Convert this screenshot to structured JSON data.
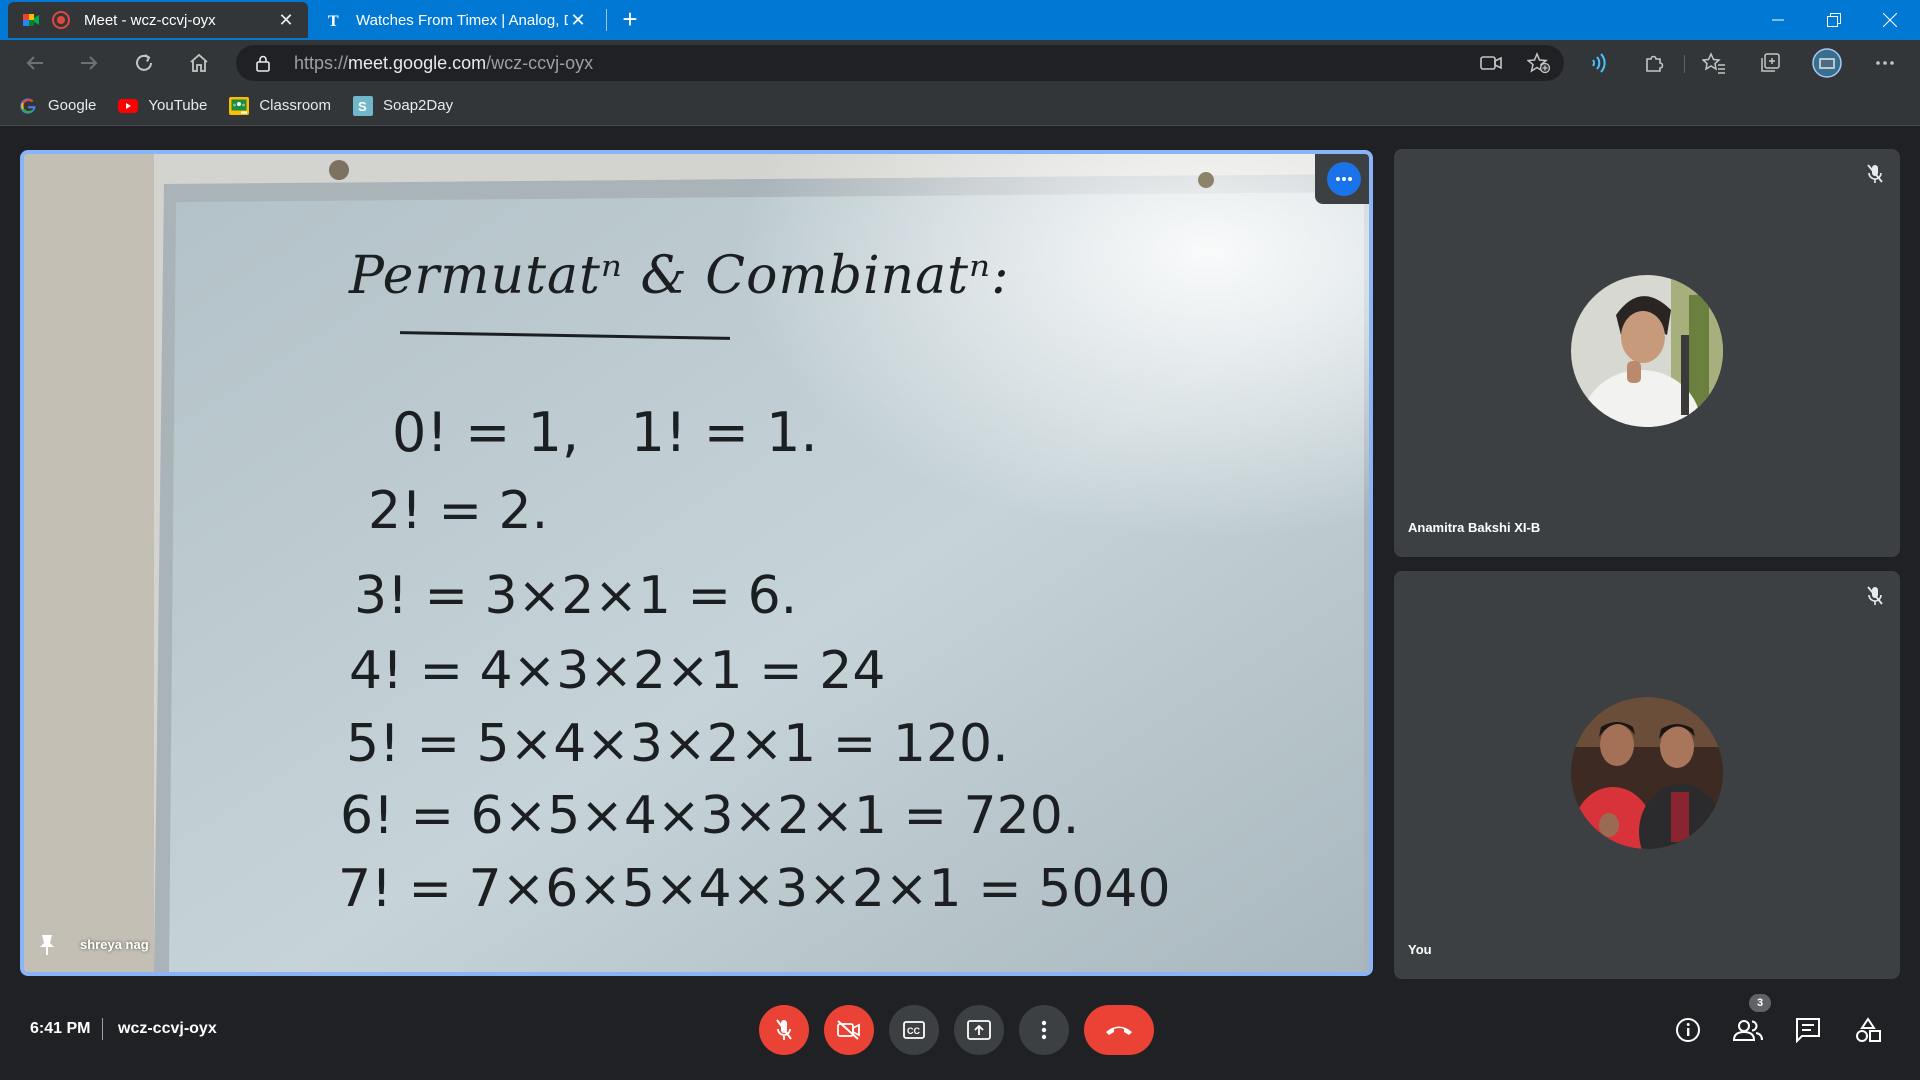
{
  "browser": {
    "tabs": [
      {
        "title": "Meet - wcz-ccvj-oyx",
        "active": true
      },
      {
        "title": "Watches From Timex | Analog, D",
        "active": false
      }
    ],
    "url_scheme": "https://",
    "url_host": "meet.google.com",
    "url_path": "/wcz-ccvj-oyx",
    "bookmarks": [
      {
        "label": "Google",
        "icon": "google-icon"
      },
      {
        "label": "YouTube",
        "icon": "youtube-icon"
      },
      {
        "label": "Classroom",
        "icon": "classroom-icon"
      },
      {
        "label": "Soap2Day",
        "icon": "soap2day-icon"
      }
    ]
  },
  "meeting": {
    "main_participant": "shreya nag",
    "whiteboard": {
      "heading": "Permutatⁿ & Combinatⁿ:",
      "lines": [
        "0! = 1,   1! = 1.",
        "2! = 2.",
        "3! = 3×2×1 = 6.",
        "4! = 4×3×2×1 = 24",
        "5! = 5×4×3×2×1 = 120.",
        "6! = 6×5×4×3×2×1 = 720.",
        "7! = 7×6×5×4×3×2×1 = 5040"
      ]
    },
    "participants": [
      {
        "name": "Anamitra Bakshi XI-B",
        "muted": true
      },
      {
        "name": "You",
        "muted": true
      }
    ],
    "time": "6:41 PM",
    "code": "wcz-ccvj-oyx",
    "participant_count": "3"
  },
  "colors": {
    "accent": "#1a73e8",
    "danger": "#ea4335",
    "tile": "#3c4043",
    "bg": "#202124",
    "edge_tab": "#0078d4"
  }
}
